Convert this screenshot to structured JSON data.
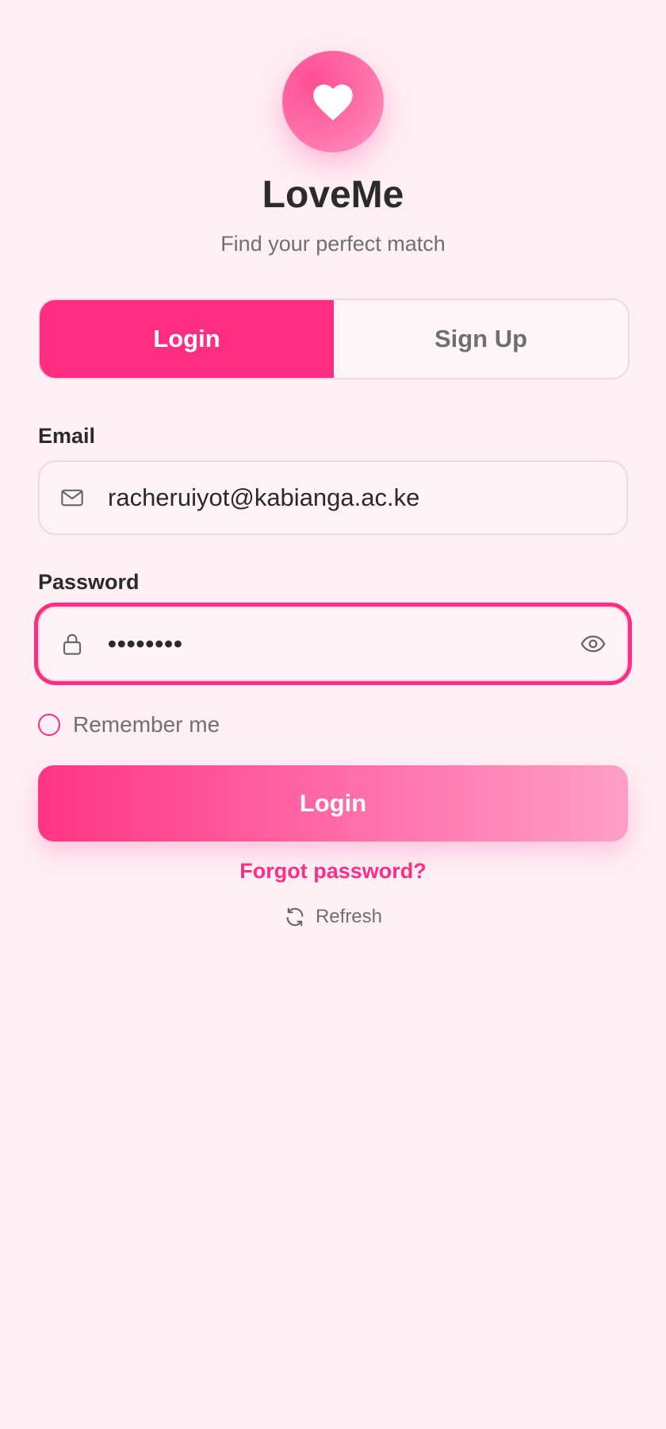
{
  "app": {
    "title": "LoveMe",
    "subtitle": "Find your perfect match",
    "logo_icon": "heart-icon"
  },
  "tabs": {
    "login": "Login",
    "signup": "Sign Up",
    "active": "login"
  },
  "email": {
    "label": "Email",
    "value": "racheruiyot@kabianga.ac.ke",
    "icon": "mail-icon"
  },
  "password": {
    "label": "Password",
    "value": "••••••••",
    "icon": "lock-icon",
    "toggle_icon": "eye-icon",
    "focused": true
  },
  "remember": {
    "label": "Remember me",
    "checked": false
  },
  "actions": {
    "login_label": "Login",
    "forgot_label": "Forgot password?",
    "refresh_label": "Refresh"
  },
  "colors": {
    "accent": "#ff2e82",
    "background": "#fff0f5",
    "text": "#2b2b2b",
    "muted": "#707070"
  }
}
